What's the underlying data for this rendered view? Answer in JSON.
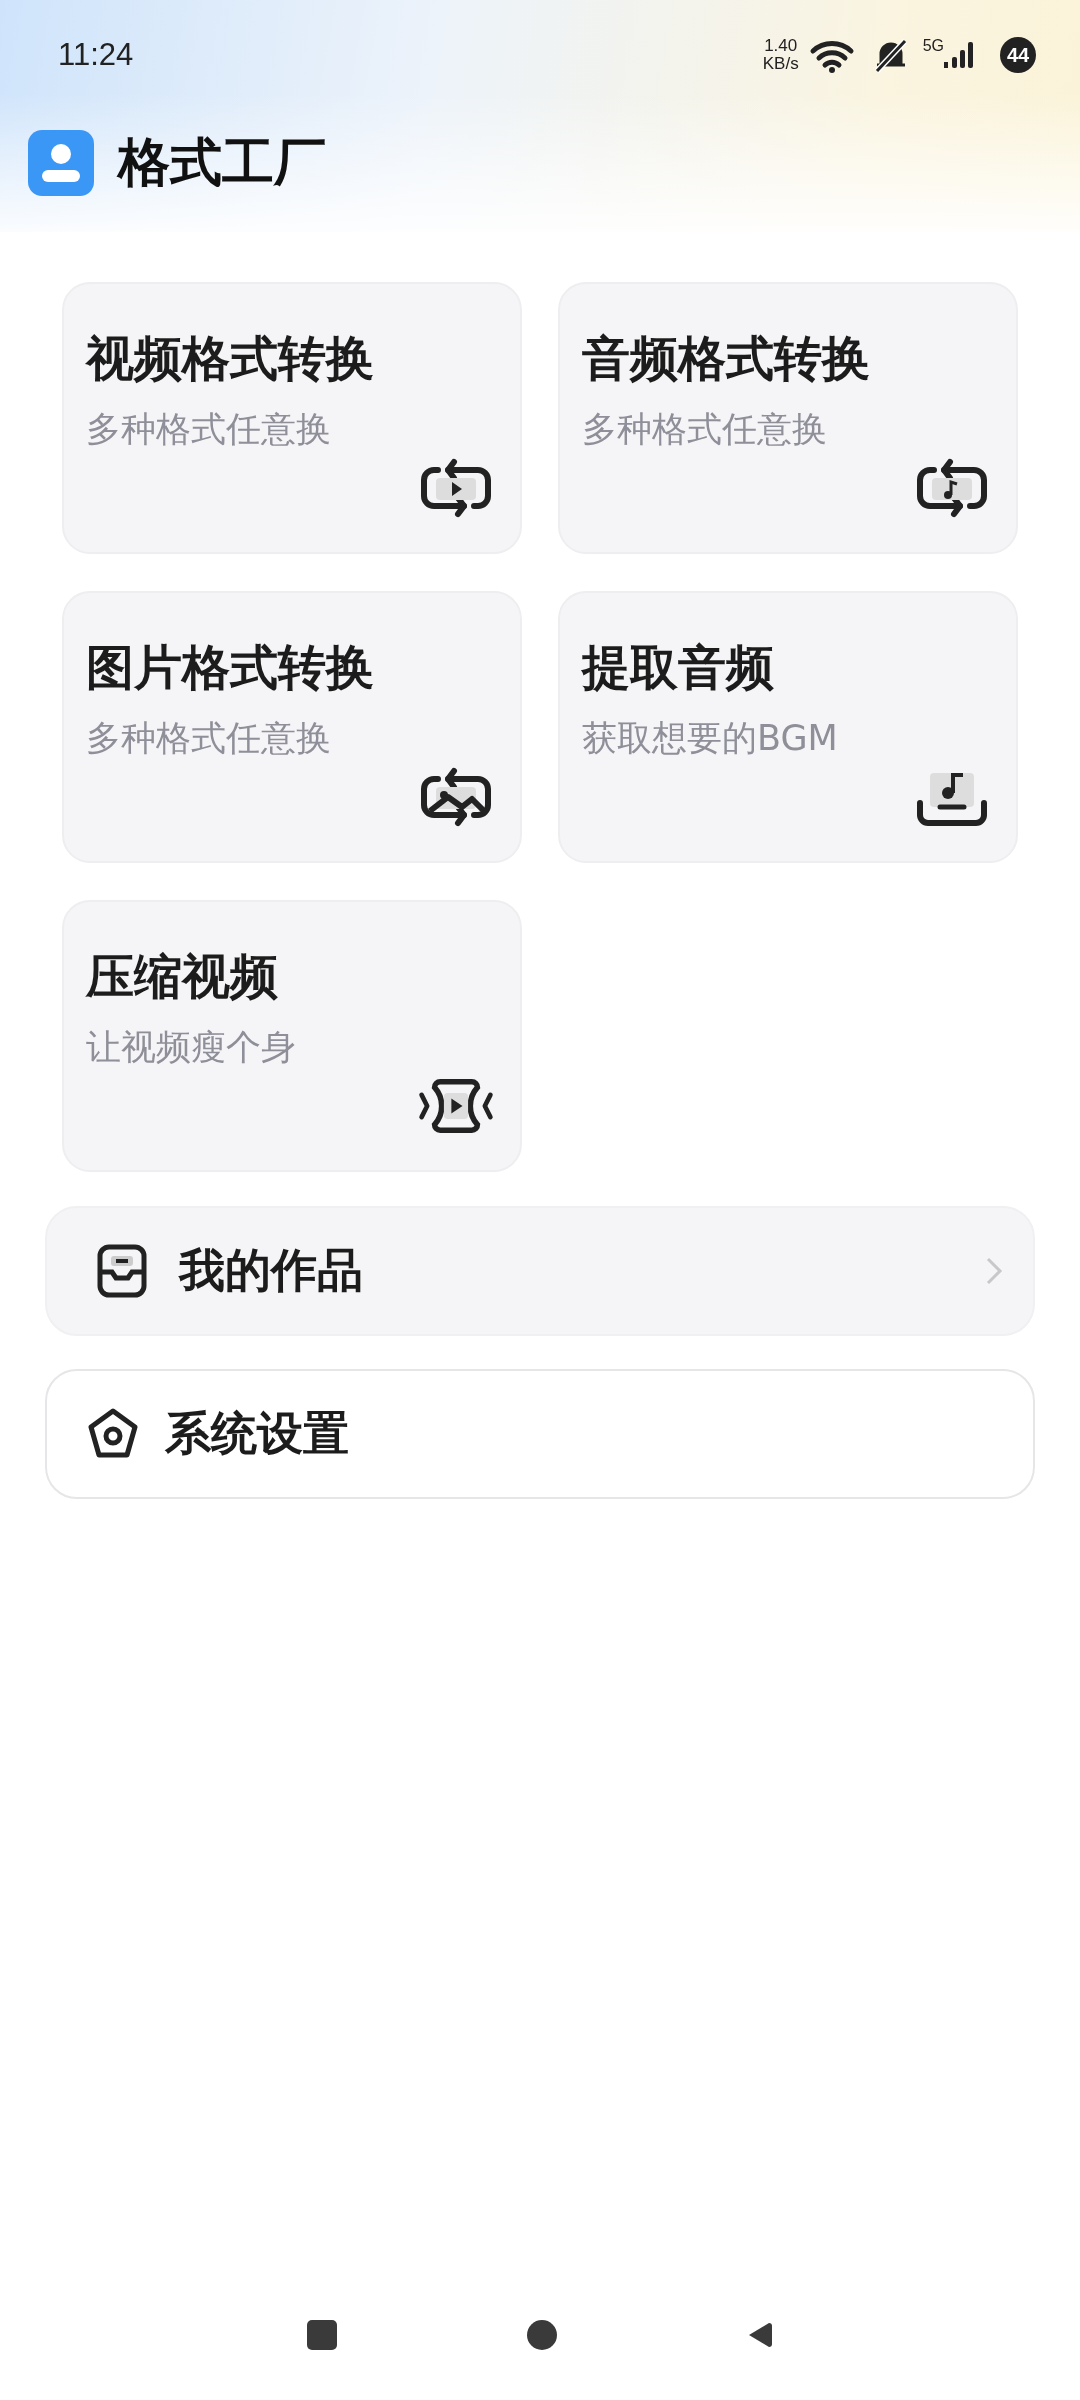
{
  "status_bar": {
    "time": "11:24",
    "net_speed": "1.40",
    "net_unit": "KB/s",
    "network": "5G",
    "battery": "44"
  },
  "header": {
    "title": "格式工厂"
  },
  "tools": [
    {
      "title": "视频格式转换",
      "subtitle": "多种格式任意换"
    },
    {
      "title": "音频格式转换",
      "subtitle": "多种格式任意换"
    },
    {
      "title": "图片格式转换",
      "subtitle": "多种格式任意换"
    },
    {
      "title": "提取音频",
      "subtitle": "获取想要的BGM"
    },
    {
      "title": "压缩视频",
      "subtitle": "让视频瘦个身"
    }
  ],
  "menu": [
    {
      "label": "我的作品",
      "kind": "filled"
    },
    {
      "label": "系统设置",
      "kind": "outlined"
    }
  ]
}
